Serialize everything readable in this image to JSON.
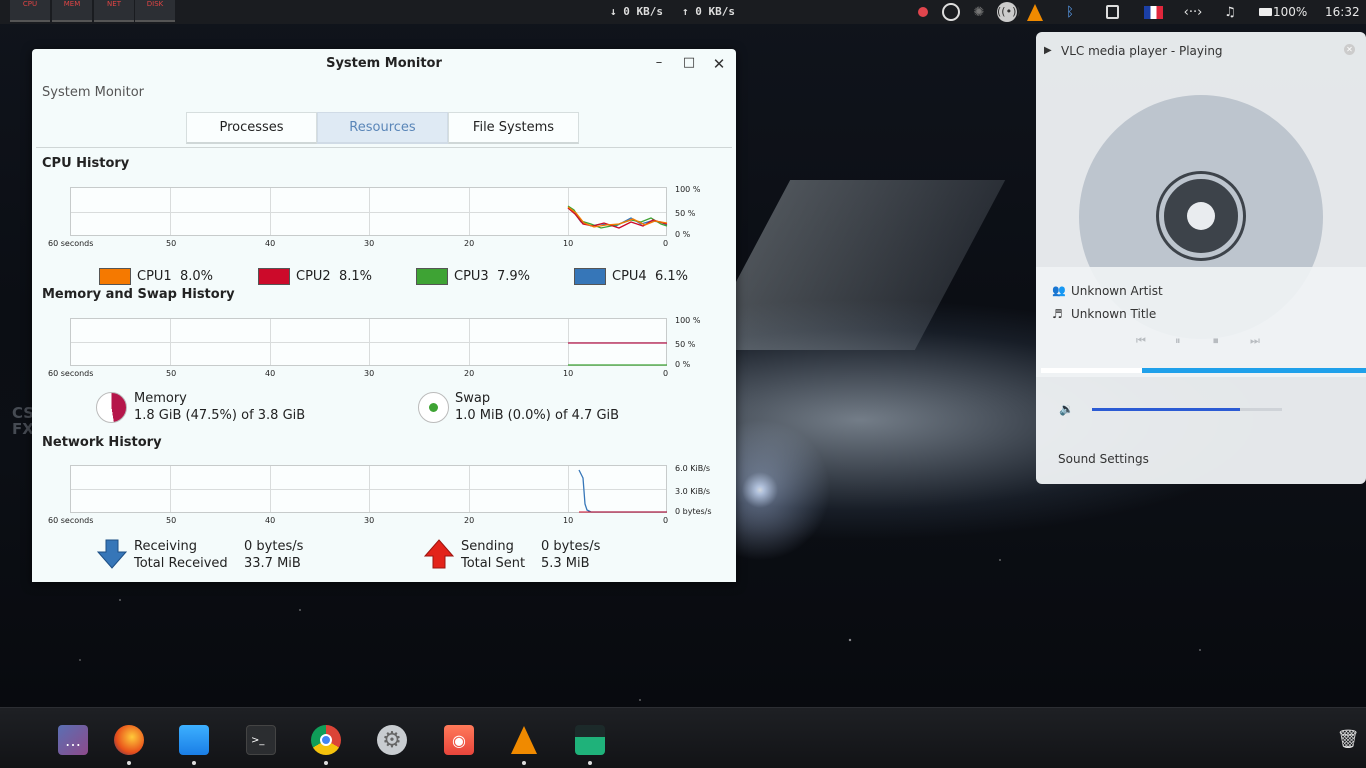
{
  "top_panel": {
    "minis": [
      "CPU",
      "MEM",
      "NET",
      "DISK"
    ],
    "down_rate": "↓ 0 KB/s",
    "up_rate": "↑ 0 KB/s",
    "battery": "100%",
    "clock": "16:32"
  },
  "window": {
    "title": "System Monitor",
    "subtitle": "System Monitor",
    "tabs": [
      "Processes",
      "Resources",
      "File Systems"
    ],
    "active_tab": "Resources",
    "cpu": {
      "heading": "CPU History",
      "y_ticks": [
        "100 %",
        "50 %",
        "0 %"
      ],
      "x_ticks": [
        "60 seconds",
        "50",
        "40",
        "30",
        "20",
        "10",
        "0"
      ],
      "legend": [
        {
          "name": "CPU1",
          "value": "8.0%",
          "color": "#f57900"
        },
        {
          "name": "CPU2",
          "value": "8.1%",
          "color": "#cc0a2a"
        },
        {
          "name": "CPU3",
          "value": "7.9%",
          "color": "#3ea334"
        },
        {
          "name": "CPU4",
          "value": "6.1%",
          "color": "#3676b8"
        }
      ]
    },
    "mem": {
      "heading": "Memory and Swap History",
      "y_ticks": [
        "100 %",
        "50 %",
        "0 %"
      ],
      "x_ticks": [
        "60 seconds",
        "50",
        "40",
        "30",
        "20",
        "10",
        "0"
      ],
      "memory_label": "Memory",
      "memory_value": "1.8 GiB (47.5%) of 3.8 GiB",
      "swap_label": "Swap",
      "swap_value": "1.0 MiB (0.0%) of 4.7 GiB",
      "memory_color": "#b5164a",
      "swap_color": "#3ea334"
    },
    "net": {
      "heading": "Network History",
      "y_ticks": [
        "6.0 KiB/s",
        "3.0 KiB/s",
        "0 bytes/s"
      ],
      "x_ticks": [
        "60 seconds",
        "50",
        "40",
        "30",
        "20",
        "10",
        "0"
      ],
      "receiving_label": "Receiving",
      "receiving_value": "0 bytes/s",
      "total_received_label": "Total Received",
      "total_received_value": "33.7 MiB",
      "sending_label": "Sending",
      "sending_value": "0 bytes/s",
      "total_sent_label": "Total Sent",
      "total_sent_value": "5.3 MiB"
    }
  },
  "vlc": {
    "title": "VLC media player - Playing",
    "artist": "Unknown Artist",
    "track": "Unknown Title",
    "progress": 0.31,
    "volume": 0.78,
    "sound_settings": "Sound Settings"
  },
  "dock": {
    "items": [
      "finder",
      "multitasking",
      "firefox",
      "files",
      "terminal",
      "chrome",
      "settings",
      "screenshot",
      "vlc",
      "system-monitor"
    ]
  },
  "wallpaper": {
    "watermark_line1": "CS",
    "watermark_line2": "FX"
  }
}
